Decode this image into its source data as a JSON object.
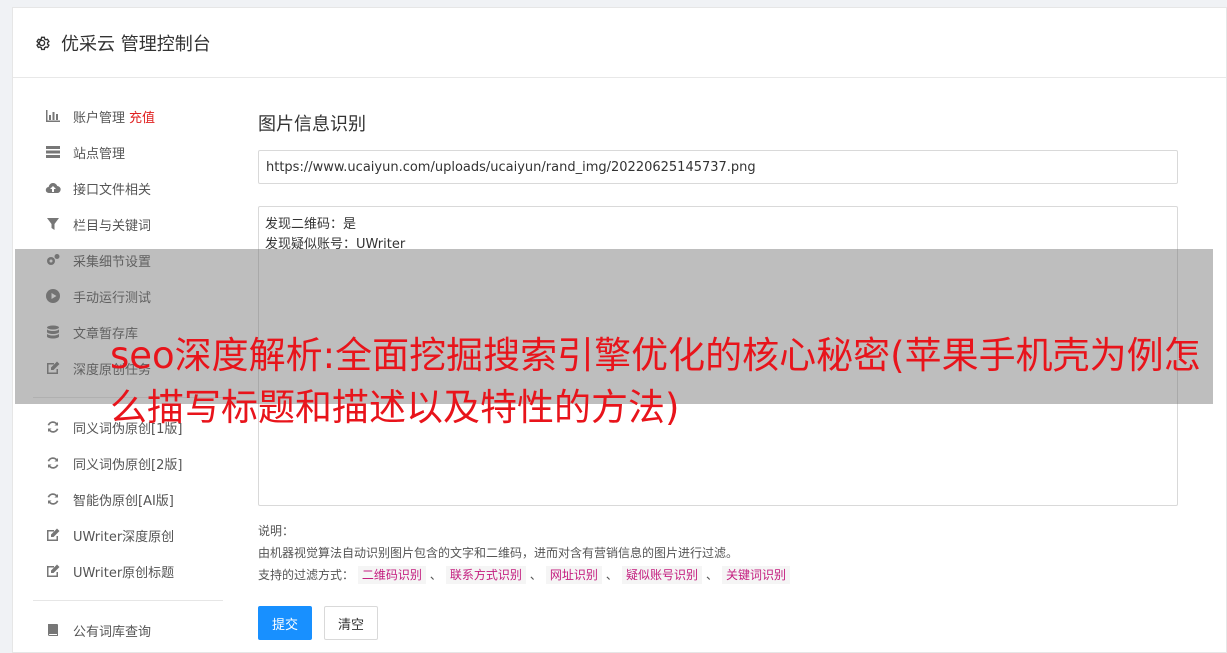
{
  "app": {
    "title": "优采云 管理控制台"
  },
  "sidebar": {
    "items": [
      {
        "label": "账户管理",
        "badge": "充值",
        "icon": "bar-chart-icon"
      },
      {
        "label": "站点管理",
        "icon": "server-icon"
      },
      {
        "label": "接口文件相关",
        "icon": "cloud-upload-icon"
      },
      {
        "label": "栏目与关键词",
        "icon": "filter-icon"
      },
      {
        "label": "采集细节设置",
        "icon": "cogs-icon"
      },
      {
        "label": "手动运行测试",
        "icon": "play-circle-icon"
      },
      {
        "label": "文章暂存库",
        "icon": "database-icon"
      },
      {
        "label": "深度原创任务",
        "icon": "edit-icon"
      },
      {
        "label": "同义词伪原创[1版]",
        "icon": "refresh-icon"
      },
      {
        "label": "同义词伪原创[2版]",
        "icon": "refresh-icon"
      },
      {
        "label": "智能伪原创[AI版]",
        "icon": "refresh-icon"
      },
      {
        "label": "UWriter深度原创",
        "icon": "edit-icon"
      },
      {
        "label": "UWriter原创标题",
        "icon": "edit-icon"
      },
      {
        "label": "公有词库查询",
        "icon": "book-icon"
      }
    ]
  },
  "main": {
    "title": "图片信息识别",
    "url_value": "https://www.ucaiyun.com/uploads/ucaiyun/rand_img/20220625145737.png",
    "result_lines": [
      "发现二维码：是",
      "发现疑似账号：UWriter"
    ],
    "desc_heading": "说明：",
    "desc_text": "由机器视觉算法自动识别图片包含的文字和二维码，进而对含有营销信息的图片进行过滤。",
    "filter_label": "支持的过滤方式：",
    "filter_separator": "、",
    "filters": [
      "二维码识别",
      "联系方式识别",
      "网址识别",
      "疑似账号识别",
      "关键词识别"
    ],
    "submit_label": "提交",
    "clear_label": "清空"
  },
  "overlay": {
    "headline": "seo深度解析:全面挖掘搜索引擎优化的核心秘密(苹果手机壳为例怎么描写标题和描述以及特性的方法)"
  },
  "colors": {
    "primary": "#1890ff",
    "badge": "#e02020",
    "tag_text": "#c41d7f",
    "headline": "#e8141b"
  }
}
